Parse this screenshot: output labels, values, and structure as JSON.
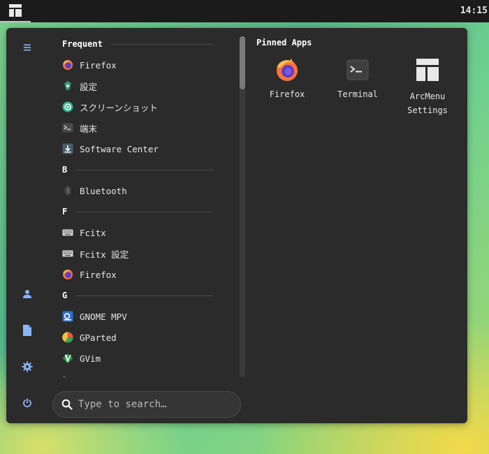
{
  "topbar": {
    "clock": "14:15"
  },
  "rail": {
    "menu_icon": "hamburger-icon",
    "user_icon": "user-icon",
    "documents_icon": "document-icon",
    "settings_icon": "gear-icon",
    "power_icon": "power-icon"
  },
  "sections": {
    "frequent": "Frequent",
    "b": "B",
    "f": "F",
    "g": "G"
  },
  "apps": {
    "frequent": [
      {
        "label": "Firefox",
        "icon": "firefox-icon"
      },
      {
        "label": "設定",
        "icon": "settings-app-icon"
      },
      {
        "label": "スクリーンショット",
        "icon": "screenshot-icon"
      },
      {
        "label": "端末",
        "icon": "terminal-icon"
      },
      {
        "label": "Software Center",
        "icon": "software-center-icon"
      }
    ],
    "b": [
      {
        "label": "Bluetooth",
        "icon": "bluetooth-icon"
      }
    ],
    "f": [
      {
        "label": "Fcitx",
        "icon": "keyboard-icon"
      },
      {
        "label": "Fcitx 設定",
        "icon": "keyboard-icon"
      },
      {
        "label": "Firefox",
        "icon": "firefox-icon"
      }
    ],
    "g": [
      {
        "label": "GNOME MPV",
        "icon": "gnome-mpv-icon"
      },
      {
        "label": "GParted",
        "icon": "gparted-icon"
      },
      {
        "label": "GVim",
        "icon": "gvim-icon"
      }
    ]
  },
  "pinned": {
    "title": "Pinned Apps",
    "items": [
      {
        "label": "Firefox",
        "icon": "firefox-icon"
      },
      {
        "label": "Terminal",
        "icon": "terminal-icon"
      },
      {
        "label_line1": "ArcMenu",
        "label_line2": "Settings",
        "icon": "arcmenu-icon"
      }
    ]
  },
  "search": {
    "placeholder": "Type to search…",
    "icon": "search-icon"
  },
  "colors": {
    "panel": "#2b2b2b",
    "accent": "#8ab4f8",
    "topbar": "#1b1b1b"
  }
}
